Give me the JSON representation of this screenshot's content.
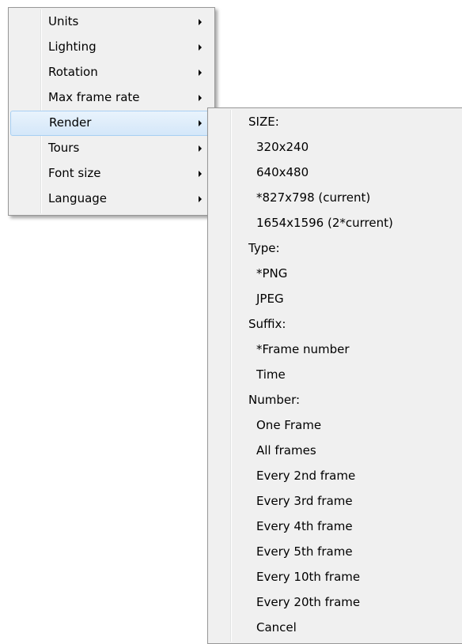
{
  "main_menu": {
    "items": [
      {
        "label": "Units"
      },
      {
        "label": "Lighting"
      },
      {
        "label": "Rotation"
      },
      {
        "label": "Max frame rate"
      },
      {
        "label": "Render"
      },
      {
        "label": "Tours"
      },
      {
        "label": "Font size"
      },
      {
        "label": "Language"
      }
    ],
    "highlighted": "Render"
  },
  "render_submenu": {
    "size_header": "SIZE:",
    "size_options": [
      "320x240",
      "640x480",
      "*827x798 (current)",
      "1654x1596 (2*current)"
    ],
    "type_header": "Type:",
    "type_options": [
      "*PNG",
      "JPEG"
    ],
    "suffix_header": "Suffix:",
    "suffix_options": [
      "*Frame number",
      "Time"
    ],
    "number_header": "Number:",
    "number_options": [
      "One Frame",
      "All frames",
      "Every 2nd frame",
      "Every 3rd frame",
      "Every 4th frame",
      "Every 5th frame",
      "Every 10th frame",
      "Every 20th frame"
    ],
    "cancel": "Cancel"
  },
  "icons": {
    "submenu_arrow": "chevron-right-icon"
  },
  "colors": {
    "menu_background": "#f0f0f0",
    "menu_border": "#979797",
    "highlight_fill": "#d4e7f9",
    "highlight_border": "#a8d0f3"
  }
}
